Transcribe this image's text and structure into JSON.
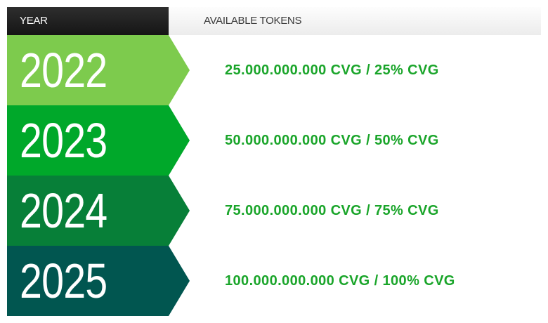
{
  "header": {
    "year_label": "YEAR",
    "tokens_label": "AVAILABLE TOKENS"
  },
  "colors": {
    "token_text": "#1aa52a",
    "row_colors": [
      "#7dcb4d",
      "#00a82a",
      "#077f38",
      "#015650"
    ]
  },
  "rows": [
    {
      "year": "2022",
      "tokens": "25.000.000.000 CVG / 25% CVG"
    },
    {
      "year": "2023",
      "tokens": "50.000.000.000 CVG / 50% CVG"
    },
    {
      "year": "2024",
      "tokens": "75.000.000.000 CVG / 75% CVG"
    },
    {
      "year": "2025",
      "tokens": "100.000.000.000 CVG / 100% CVG"
    }
  ]
}
